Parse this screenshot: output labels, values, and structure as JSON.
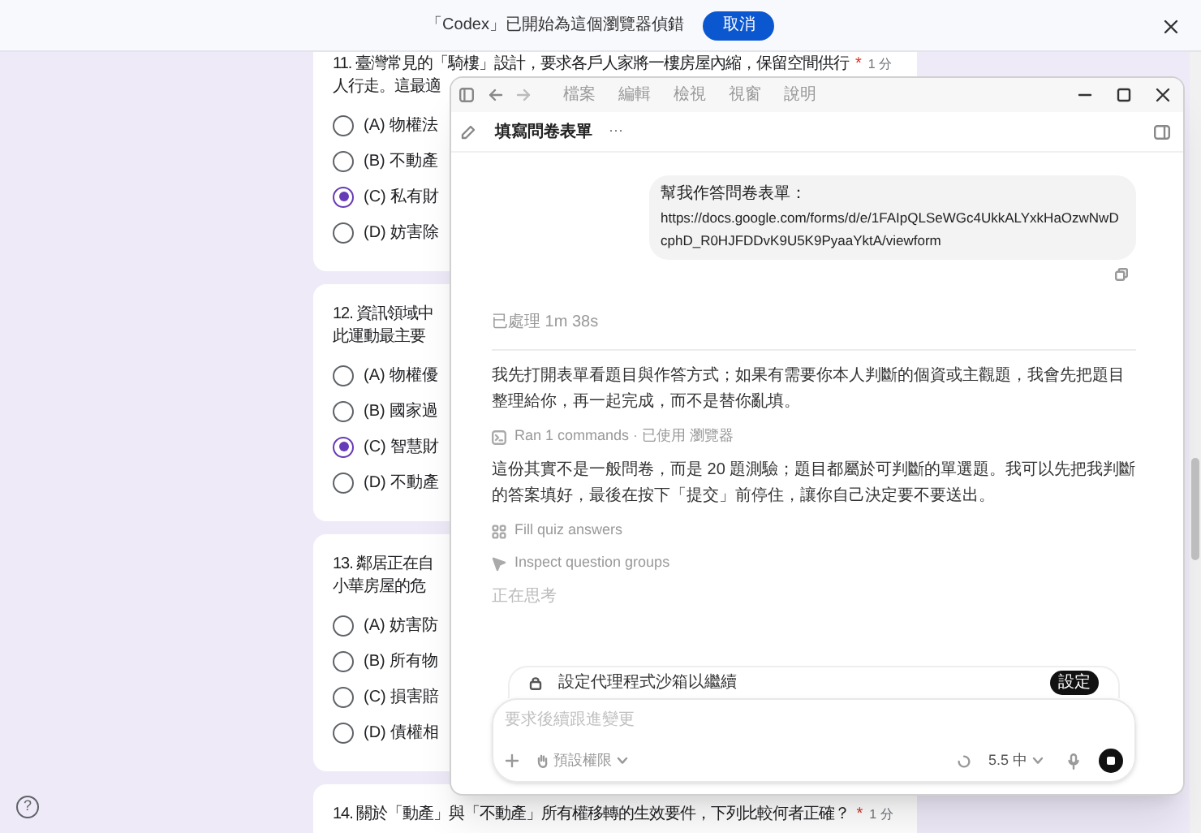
{
  "notification": {
    "message": "「Codex」已開始為這個瀏覽器偵錯",
    "button": "取消"
  },
  "form": {
    "questions": [
      {
        "lines": [
          "11. 臺灣常見的「騎樓」設計，要求各戶人家將一樓房屋內縮，保留空間供行",
          "人行走。這最適"
        ],
        "mark": "*",
        "points": "1 分",
        "options": [
          {
            "label": "(A) 物權法",
            "selected": false
          },
          {
            "label": "(B) 不動產",
            "selected": false
          },
          {
            "label": "(C) 私有財",
            "selected": true
          },
          {
            "label": "(D) 妨害除",
            "selected": false
          }
        ]
      },
      {
        "lines": [
          "12. 資訊領域中",
          "此運動最主要"
        ],
        "options": [
          {
            "label": "(A) 物權優",
            "selected": false
          },
          {
            "label": "(B) 國家過",
            "selected": false
          },
          {
            "label": "(C) 智慧財",
            "selected": true
          },
          {
            "label": "(D) 不動產",
            "selected": false
          }
        ]
      },
      {
        "lines": [
          "13. 鄰居正在自",
          "小華房屋的危"
        ],
        "options": [
          {
            "label": "(A) 妨害防",
            "selected": false
          },
          {
            "label": "(B) 所有物",
            "selected": false
          },
          {
            "label": "(C) 損害賠",
            "selected": false
          },
          {
            "label": "(D) 債權相",
            "selected": false
          }
        ]
      },
      {
        "lines": [
          "14. 關於「動產」與「不動產」所有權移轉的生效要件，下列比較何者正確？"
        ],
        "mark": "*",
        "points": "1 分"
      }
    ]
  },
  "help": "?",
  "app": {
    "menu": [
      "檔案",
      "編輯",
      "檢視",
      "視窗",
      "說明"
    ],
    "title": "填寫問卷表單",
    "more": "···",
    "user_message": {
      "lines": [
        "幫我作答問卷表單：",
        "https://docs.google.com/forms/d/e/1FAIpQLSeWGc4UkkALYxkHaOzwNwDcphD_R0HJFDDvK9U5K9PyaaYktA/viewform"
      ]
    },
    "elapsed": "已處理 1m 38s",
    "transcript": [
      {
        "kind": "text",
        "text": "我先打開表單看題目與作答方式；如果有需要你本人判斷的個資或主觀題，我會先把題目整理給你，再一起完成，而不是替你亂填。"
      },
      {
        "kind": "command",
        "text": "Ran 1 commands · 已使用 瀏覽器"
      },
      {
        "kind": "text",
        "text": "這份其實不是一般問卷，而是 20 題測驗；題目都屬於可判斷的單選題。我可以先把我判斷的答案填好，最後在按下「提交」前停住，讓你自己決定要不要送出。"
      },
      {
        "kind": "quiz",
        "text": "Fill quiz answers"
      },
      {
        "kind": "inspect",
        "text": "Inspect question groups"
      },
      {
        "kind": "thinking",
        "text": "正在思考"
      }
    ],
    "sandbox": {
      "text": "設定代理程式沙箱以繼續",
      "button": "設定"
    },
    "composer": {
      "placeholder": "要求後續跟進變更",
      "permission": "預設權限",
      "model": "5.5 中"
    }
  }
}
